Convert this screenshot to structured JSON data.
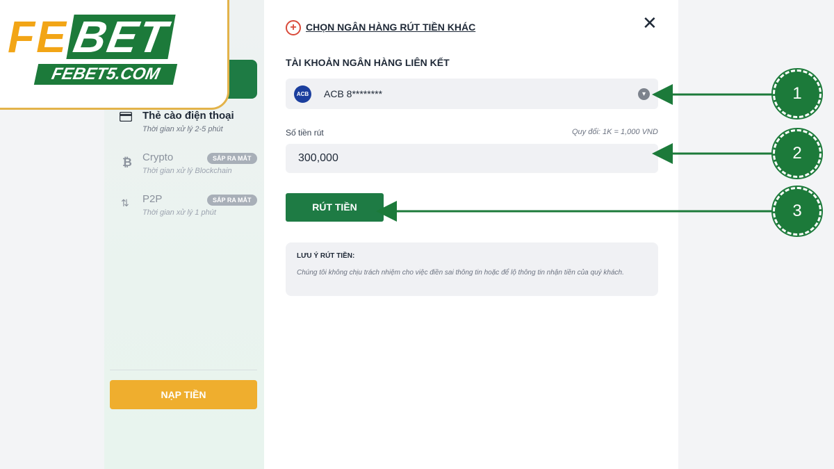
{
  "brand": {
    "logo_fe": "FE",
    "logo_bet": "BET",
    "domain": "FEBET5.COM"
  },
  "sidebar": {
    "methods": [
      {
        "icon": "card-icon",
        "title": "Thẻ cào điện thoại",
        "subtitle": "Thời gian xử lý 2-5 phút",
        "badge": ""
      },
      {
        "icon": "bitcoin-icon",
        "title": "Crypto",
        "subtitle": "Thời gian xử lý Blockchain",
        "badge": "SẮP RA MẮT"
      },
      {
        "icon": "p2p-icon",
        "title": "P2P",
        "subtitle": "Thời gian xử lý 1 phút",
        "badge": "SẮP RA MẮT"
      }
    ],
    "deposit_label": "NẠP TIỀN"
  },
  "main": {
    "choose_other_bank": "CHỌN NGÂN HÀNG RÚT TIỀN KHÁC",
    "linked_account_title": "TÀI KHOẢN NGÂN HÀNG LIÊN KẾT",
    "bank_logo_text": "ACB",
    "bank_value": "ACB 8********",
    "amount_label": "Số tiền rút",
    "rate_note": "Quy đổi: 1K = 1,000 VND",
    "amount_value": "300,000",
    "withdraw_label": "RÚT TIỀN",
    "note_title": "LƯU Ý RÚT TIỀN:",
    "note_text": "Chúng tôi không chịu trách nhiệm cho việc điền sai thông tin hoặc để lộ thông tin nhận tiền của quý khách."
  },
  "steps": [
    "1",
    "2",
    "3"
  ],
  "colors": {
    "primary_green": "#1e7b44",
    "deposit_orange": "#efae2e",
    "logo_gold": "#f2a516",
    "alert_red": "#d94a3a"
  }
}
